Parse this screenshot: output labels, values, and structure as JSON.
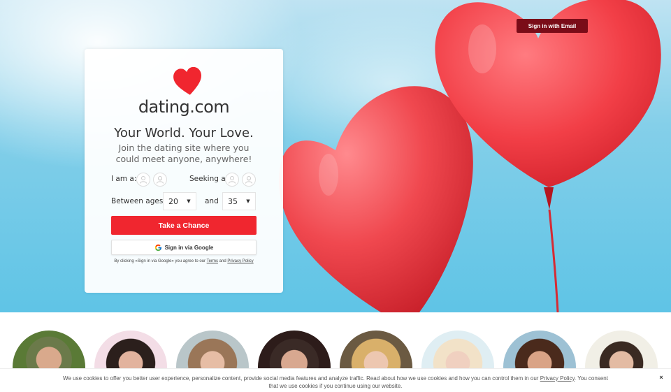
{
  "header": {
    "signin_email_label": "Sign in with Email"
  },
  "brand": {
    "logo_text": "dating.com",
    "accent_color": "#f0262f"
  },
  "hero": {
    "headline": "Your World. Your Love.",
    "subline": "Join the dating site where you could meet anyone, anywhere!"
  },
  "form": {
    "i_am_label": "I am a:",
    "seeking_label": "Seeking a:",
    "ages_label": "Between ages:",
    "and_label": "and",
    "age_min": "20",
    "age_max": "35",
    "cta_label": "Take a Chance",
    "google_label": "Sign in via Google",
    "legal_prefix": "By clicking «Sign in via Google» you agree to our",
    "legal_terms": "Terms",
    "legal_and": "and",
    "legal_privacy": "Privacy Policy"
  },
  "profiles": {
    "count": 8
  },
  "cookie": {
    "text": "We use cookies to offer you better user experience, personalize content, provide social media features and analyze traffic. Read about how we use cookies and how you can control them in our",
    "policy_link": "Privacy Policy",
    "text_suffix": ". You consent that we use cookies if you continue using our website.",
    "close_label": "×"
  }
}
